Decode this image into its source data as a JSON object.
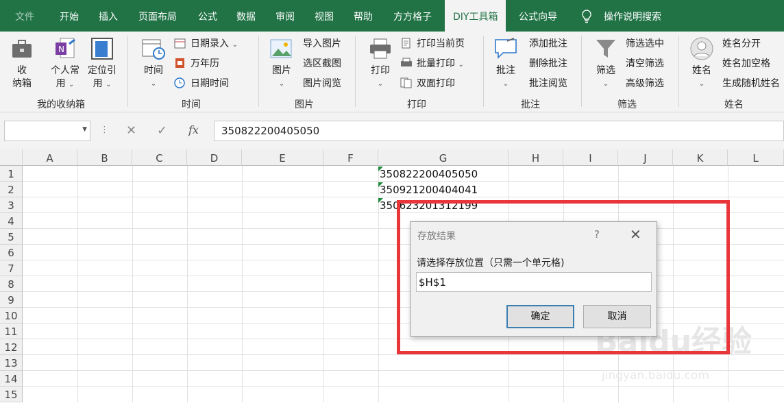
{
  "tabs": [
    "文件",
    "开始",
    "插入",
    "页面布局",
    "公式",
    "数据",
    "审阅",
    "视图",
    "帮助",
    "方方格子",
    "DIY工具箱",
    "公式向导",
    "操作说明搜索"
  ],
  "ribbon": {
    "groups": {
      "storage": {
        "label": "我的收纳箱",
        "receive_line1": "收",
        "receive_line2": "纳箱",
        "personal": "个人常",
        "personal2": "用",
        "locate": "定位引",
        "locate2": "用"
      },
      "time": {
        "label": "时间",
        "big": "时间",
        "date_entry": "日期录入",
        "calendar": "万年历",
        "datetime": "日期时间"
      },
      "image": {
        "label": "图片",
        "big": "图片",
        "import": "导入图片",
        "capture": "选区截图",
        "browse": "图片阅览"
      },
      "print": {
        "label": "打印",
        "big": "打印",
        "current": "打印当前页",
        "batch": "批量打印",
        "duplex": "双面打印"
      },
      "comment": {
        "label": "批注",
        "big": "批注",
        "add": "添加批注",
        "delete": "删除批注",
        "browse": "批注阅览"
      },
      "filter": {
        "label": "筛选",
        "big": "筛选",
        "select": "筛选选中",
        "clear": "清空筛选",
        "advanced": "高级筛选"
      },
      "name": {
        "label": "姓名",
        "big": "姓名",
        "split": "姓名分开",
        "space": "姓名加空格",
        "random": "生成随机姓名"
      }
    }
  },
  "formula_bar": {
    "name_box": "",
    "fx": "fx",
    "value": "350822200405050"
  },
  "columns": [
    "A",
    "B",
    "C",
    "D",
    "E",
    "F",
    "G",
    "H",
    "I",
    "J",
    "K",
    "L"
  ],
  "rows": [
    "1",
    "2",
    "3",
    "4",
    "5",
    "6",
    "7",
    "8",
    "9",
    "10",
    "11",
    "12",
    "13",
    "14",
    "15"
  ],
  "cells": [
    "350822200405050",
    "350921200404041",
    "350623201312199"
  ],
  "dialog": {
    "title": "存放结果",
    "help": "?",
    "close": "✕",
    "prompt": "请选择存放位置（只需一个单元格)",
    "input_value": "$H$1",
    "ok": "确定",
    "cancel": "取消"
  },
  "watermark": {
    "brand": "Baidu经验",
    "url": "jingyan.baidu.com"
  },
  "colors": {
    "tab_bar": "#217346",
    "highlight": "#e8363b"
  }
}
